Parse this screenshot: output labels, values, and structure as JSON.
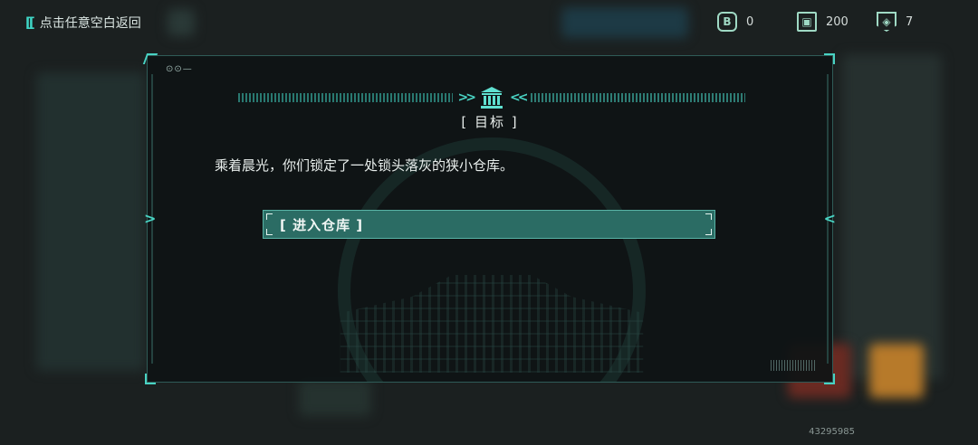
{
  "topbar": {
    "back_label": "点击任意空白返回",
    "resources": [
      {
        "icon": "coin-b-icon",
        "glyph": "B",
        "value": "0"
      },
      {
        "icon": "chip-icon",
        "glyph": "▣",
        "value": "200"
      },
      {
        "icon": "badge-icon",
        "glyph": "◈",
        "value": "7"
      }
    ]
  },
  "panel": {
    "status_dots": "⊙⊙—",
    "title": "[ 目标 ]",
    "story_text": "乘着晨光，你们锁定了一处锁头落灰的狭小仓库。",
    "choice_label": "[ 进入仓库 ]"
  },
  "footer": {
    "uid": "43295985"
  },
  "colors": {
    "accent": "#49d3c3",
    "choice_bg": "#2b6c64",
    "panel_bg": "#0e1415"
  }
}
